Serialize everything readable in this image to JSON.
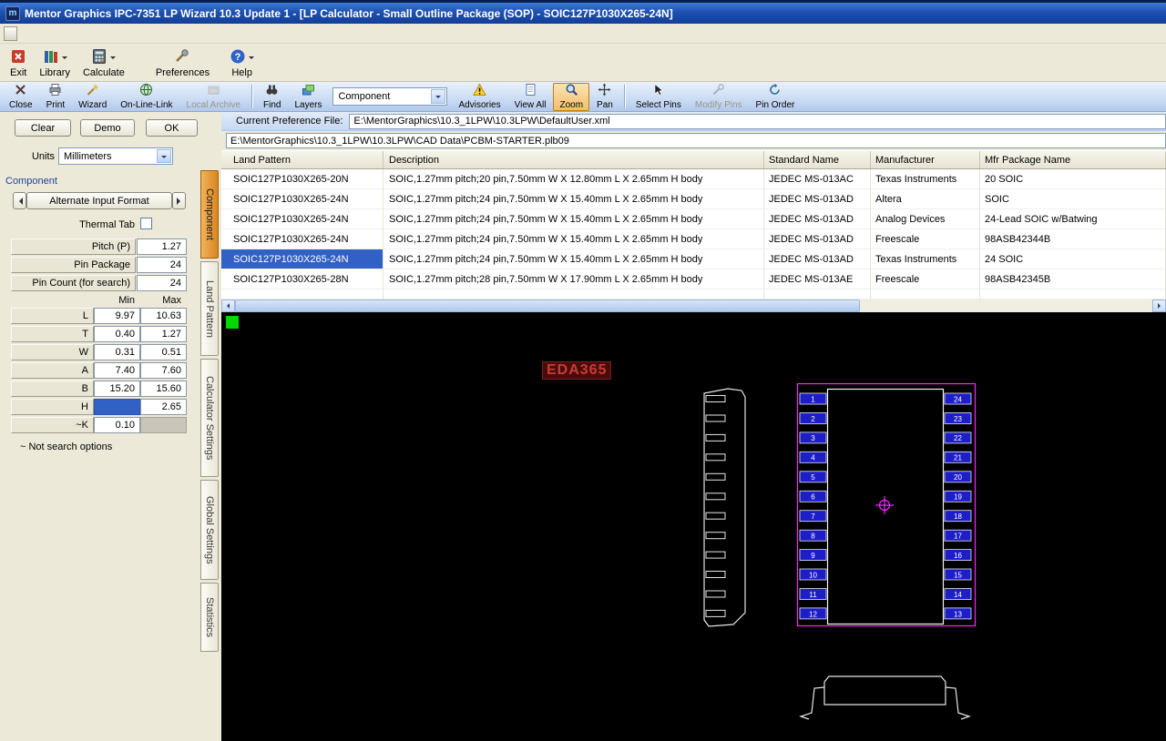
{
  "window": {
    "title": "Mentor Graphics IPC-7351 LP Wizard 10.3 Update 1 - [LP Calculator - Small Outline Package (SOP) - SOIC127P1030X265-24N]"
  },
  "toolbar_main": {
    "exit": "Exit",
    "library": "Library",
    "calculate": "Calculate",
    "preferences": "Preferences",
    "help": "Help"
  },
  "toolbar_view": {
    "close": "Close",
    "print": "Print",
    "wizard": "Wizard",
    "online_link": "On-Line-Link",
    "local_archive": "Local Archive",
    "find": "Find",
    "layers": "Layers",
    "component_combo": "Component",
    "advisories": "Advisories",
    "view_all": "View All",
    "zoom": "Zoom",
    "pan": "Pan",
    "select_pins": "Select Pins",
    "modify_pins": "Modify Pins",
    "pin_order": "Pin Order"
  },
  "preference": {
    "label": "Current Preference File:",
    "value": "E:\\MentorGraphics\\10.3_1LPW\\10.3LPW\\DefaultUser.xml"
  },
  "library_path": "E:\\MentorGraphics\\10.3_1LPW\\10.3LPW\\CAD Data\\PCBM-STARTER.plb09",
  "results_table": {
    "columns": [
      "Land Pattern",
      "Description",
      "Standard Name",
      "Manufacturer",
      "Mfr Package Name"
    ],
    "rows": [
      {
        "land_pattern": "SOIC127P1030X265-20N",
        "description": "SOIC,1.27mm pitch;20 pin,7.50mm W X 12.80mm L X 2.65mm H body",
        "standard_name": "JEDEC MS-013AC",
        "manufacturer": "Texas Instruments",
        "mfr_package_name": "20 SOIC"
      },
      {
        "land_pattern": "SOIC127P1030X265-24N",
        "description": "SOIC,1.27mm pitch;24 pin,7.50mm W X 15.40mm L X 2.65mm H body",
        "standard_name": "JEDEC MS-013AD",
        "manufacturer": "Altera",
        "mfr_package_name": "SOIC"
      },
      {
        "land_pattern": "SOIC127P1030X265-24N",
        "description": "SOIC,1.27mm pitch;24 pin,7.50mm W X 15.40mm L X 2.65mm H body",
        "standard_name": "JEDEC MS-013AD",
        "manufacturer": "Analog Devices",
        "mfr_package_name": "24-Lead SOIC w/Batwing"
      },
      {
        "land_pattern": "SOIC127P1030X265-24N",
        "description": "SOIC,1.27mm pitch;24 pin,7.50mm W X 15.40mm L X 2.65mm H body",
        "standard_name": "JEDEC MS-013AD",
        "manufacturer": "Freescale",
        "mfr_package_name": "98ASB42344B"
      },
      {
        "land_pattern": "SOIC127P1030X265-24N",
        "description": "SOIC,1.27mm pitch;24 pin,7.50mm W X 15.40mm L X 2.65mm H body",
        "standard_name": "JEDEC MS-013AD",
        "manufacturer": "Texas Instruments",
        "mfr_package_name": "24 SOIC",
        "selected": true
      },
      {
        "land_pattern": "SOIC127P1030X265-28N",
        "description": "SOIC,1.27mm pitch;28 pin,7.50mm W X 17.90mm L X 2.65mm H body",
        "standard_name": "JEDEC MS-013AE",
        "manufacturer": "Freescale",
        "mfr_package_name": "98ASB42345B"
      }
    ]
  },
  "panel": {
    "clear": "Clear",
    "demo": "Demo",
    "ok": "OK",
    "units_label": "Units",
    "units_value": "Millimeters",
    "section": "Component",
    "alt_input": "Alternate Input Format",
    "thermal_tab": "Thermal Tab",
    "params": [
      {
        "label": "Pitch (P)",
        "value": "1.27"
      },
      {
        "label": "Pin Package",
        "value": "24"
      },
      {
        "label": "Pin Count (for search)",
        "value": "24"
      }
    ],
    "minmax": {
      "min_header": "Min",
      "max_header": "Max",
      "rows": [
        {
          "label": "L",
          "min": "9.97",
          "max": "10.63"
        },
        {
          "label": "T",
          "min": "0.40",
          "max": "1.27"
        },
        {
          "label": "W",
          "min": "0.31",
          "max": "0.51"
        },
        {
          "label": "A",
          "min": "7.40",
          "max": "7.60"
        },
        {
          "label": "B",
          "min": "15.20",
          "max": "15.60"
        },
        {
          "label": "H",
          "min": "",
          "max": "2.65"
        },
        {
          "label": "~K",
          "min": "0.10",
          "max": ""
        }
      ]
    },
    "note": "~ Not search options"
  },
  "tabs": [
    {
      "label": "Component",
      "selected": true
    },
    {
      "label": "Land Pattern"
    },
    {
      "label": "Calculator Settings"
    },
    {
      "label": "Global Settings"
    },
    {
      "label": "Statistics"
    }
  ],
  "canvas": {
    "watermark": "EDA365",
    "left_pins": [
      1,
      2,
      3,
      4,
      5,
      6,
      7,
      8,
      9,
      10,
      11,
      12
    ],
    "right_pins": [
      24,
      23,
      22,
      21,
      20,
      19,
      18,
      17,
      16,
      15,
      14,
      13
    ]
  }
}
